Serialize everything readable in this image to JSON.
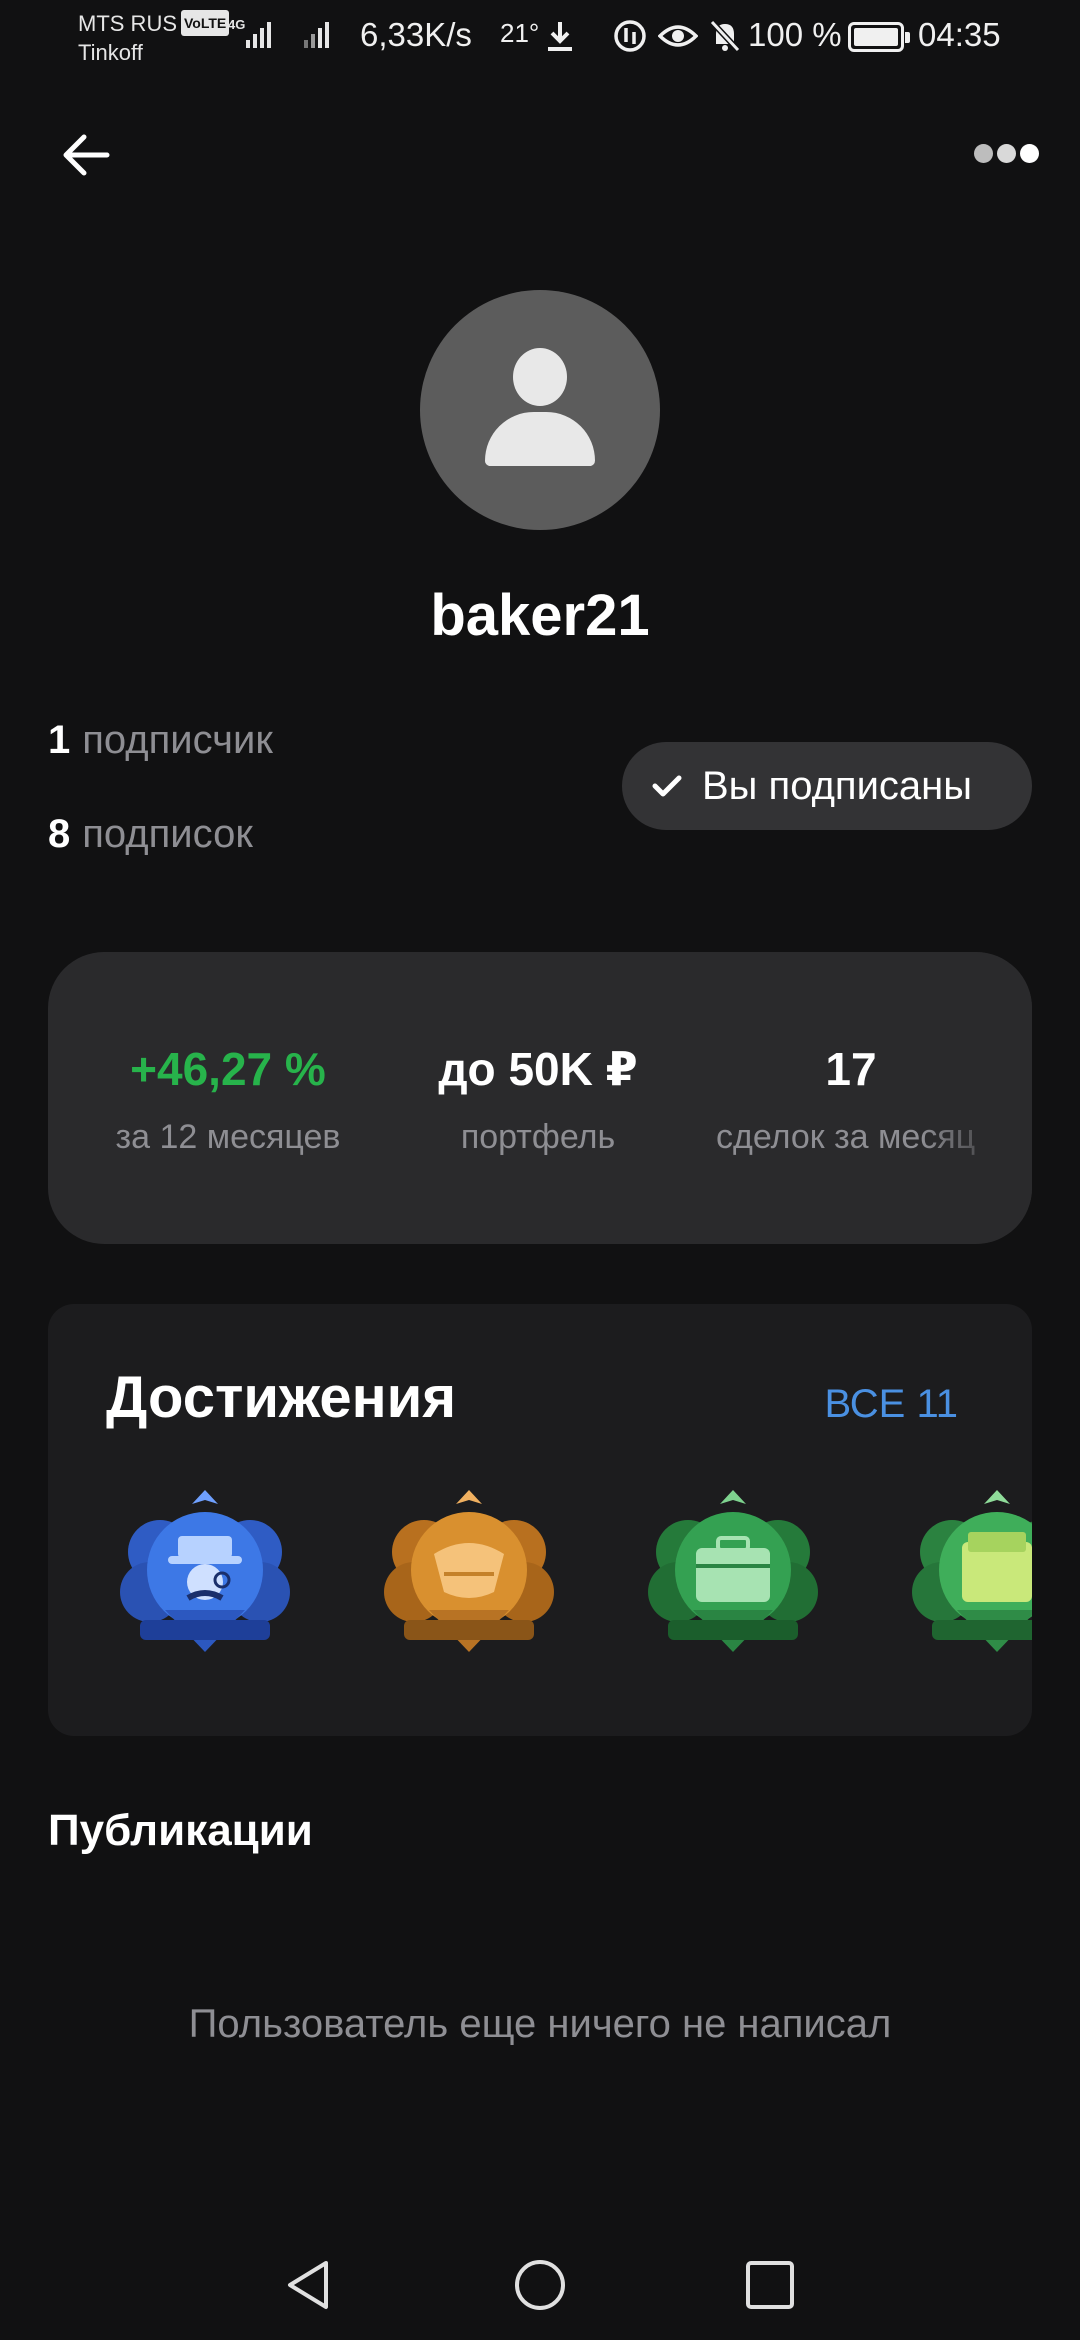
{
  "status_bar": {
    "carrier": "MTS RUS",
    "volte": "VoLTE",
    "network": "4G",
    "carrier2": "Tinkoff",
    "speed": "6,33K/s",
    "temperature": "21°",
    "battery": "100 %",
    "time": "04:35"
  },
  "profile": {
    "username": "baker21",
    "followers_count": "1",
    "followers_label": "подписчик",
    "following_count": "8",
    "following_label": "подписок",
    "subscribed_label": "Вы подписаны"
  },
  "stats": [
    {
      "value": "+46,27 %",
      "label": "за 12 месяцев",
      "color": "#27b34b"
    },
    {
      "value": "до 50K ₽",
      "label": "портфель"
    },
    {
      "value": "17",
      "label": "сделок за месяц"
    }
  ],
  "achievements": {
    "title": "Достижения",
    "all_label": "ВСЕ 11",
    "badges": [
      {
        "icon": "investor-badge-icon",
        "color": "#3a6fe0"
      },
      {
        "icon": "handshake-badge-icon",
        "color": "#d08a2e"
      },
      {
        "icon": "briefcase-badge-icon",
        "color": "#2f9a4a"
      },
      {
        "icon": "cash-badge-icon",
        "color": "#3aa657"
      }
    ]
  },
  "publications": {
    "title": "Публикации",
    "empty_text": "Пользователь еще ничего не написал"
  }
}
